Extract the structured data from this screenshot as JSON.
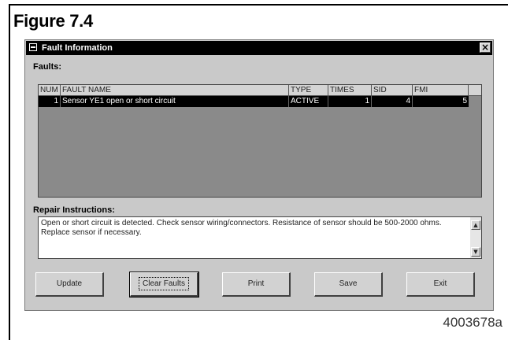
{
  "figure": {
    "title": "Figure 7.4",
    "code": "4003678a"
  },
  "window": {
    "title": "Fault Information",
    "close_glyph": "×"
  },
  "faults": {
    "label": "Faults:",
    "columns": [
      "NUM",
      "FAULT NAME",
      "TYPE",
      "TIMES",
      "SID",
      "FMI"
    ],
    "rows": [
      {
        "num": "1",
        "name": "Sensor YE1 open or short circuit",
        "type": "ACTIVE",
        "times": "1",
        "sid": "4",
        "fmi": "5",
        "selected": true
      }
    ]
  },
  "repair": {
    "label": "Repair Instructions:",
    "text": "Open or short circuit is detected. Check sensor wiring/connectors. Resistance of sensor should be 500-2000 ohms. Replace sensor if necessary."
  },
  "buttons": {
    "update": "Update",
    "clear_faults": "Clear Faults",
    "print": "Print",
    "save": "Save",
    "exit": "Exit"
  },
  "icons": {
    "scroll_up": "▲",
    "scroll_down": "▼"
  }
}
